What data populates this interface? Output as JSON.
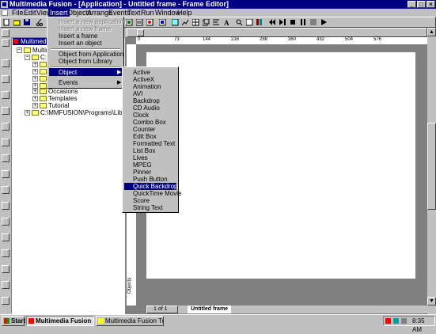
{
  "window": {
    "title": "Multimedia Fusion - [Application] - Untitled frame - Frame Editor]",
    "controls": [
      "_",
      "□",
      "×"
    ]
  },
  "menubar": [
    {
      "label": "File"
    },
    {
      "label": "Edit"
    },
    {
      "label": "View"
    },
    {
      "label": "Insert",
      "active": true
    },
    {
      "label": "Objects"
    },
    {
      "label": "Arrange"
    },
    {
      "label": "Events"
    },
    {
      "label": "Text"
    },
    {
      "label": "Run"
    },
    {
      "label": "Window"
    },
    {
      "label": "Help"
    }
  ],
  "insert_menu": {
    "items": [
      {
        "label": "Insert a new application",
        "disabled": true
      },
      {
        "label": "Insert a new frame",
        "disabled": true
      },
      {
        "label": "Insert a frame"
      },
      {
        "label": "Insert an object"
      },
      {
        "label": "Object from Application"
      },
      {
        "label": "Object from Library"
      },
      {
        "label": "Object",
        "highlighted": true,
        "submenu": true
      },
      {
        "label": "Events",
        "submenu": true
      }
    ]
  },
  "object_submenu": {
    "items": [
      "Active",
      "ActiveX",
      "Animation",
      "AVI",
      "Backdrop",
      "CD Audio",
      "Clock",
      "Combo Box",
      "Counter",
      "Edit Box",
      "Formatted Text",
      "List Box",
      "Lives",
      "MPEG",
      "Pinner",
      "Push Button",
      "Quick Backdrop",
      "QuickTime Movie",
      "Score",
      "String Text"
    ],
    "highlighted": "Quick Backdrop"
  },
  "workspace": {
    "panel_title": "Multimedia F",
    "tree": [
      {
        "label": "Multime",
        "level": 0
      },
      {
        "label": "C:\\M",
        "level": 1
      },
      {
        "label": "",
        "level": 2
      },
      {
        "label": "",
        "level": 2
      },
      {
        "label": "",
        "level": 2
      },
      {
        "label": "",
        "level": 2
      },
      {
        "label": "",
        "level": 2
      },
      {
        "label": "",
        "level": 2
      },
      {
        "label": "Occasions",
        "level": 2
      },
      {
        "label": "Templates",
        "level": 2
      },
      {
        "label": "Tutorial",
        "level": 2
      },
      {
        "label": "C:\\MMFUSION\\Programs\\Library",
        "level": 1
      }
    ]
  },
  "ruler": {
    "top": [
      "0",
      "73",
      "144",
      "216",
      "288",
      "360",
      "432",
      "504",
      "576"
    ],
    "left_label": "Objects"
  },
  "frame_tabs": {
    "page": "1 of 1",
    "tab": "Untitled frame"
  },
  "taskbar": {
    "start": "Start",
    "tasks": [
      {
        "label": "Multimedia Fusion - [...",
        "active": true
      },
      {
        "label": "Multimedia Fusion Tutorial ..."
      }
    ],
    "clock": "8:35 AM"
  },
  "colors": {
    "titlebar": "#000080",
    "highlight": "#000080",
    "face": "#c0c0c0",
    "workspace": "#808080"
  }
}
